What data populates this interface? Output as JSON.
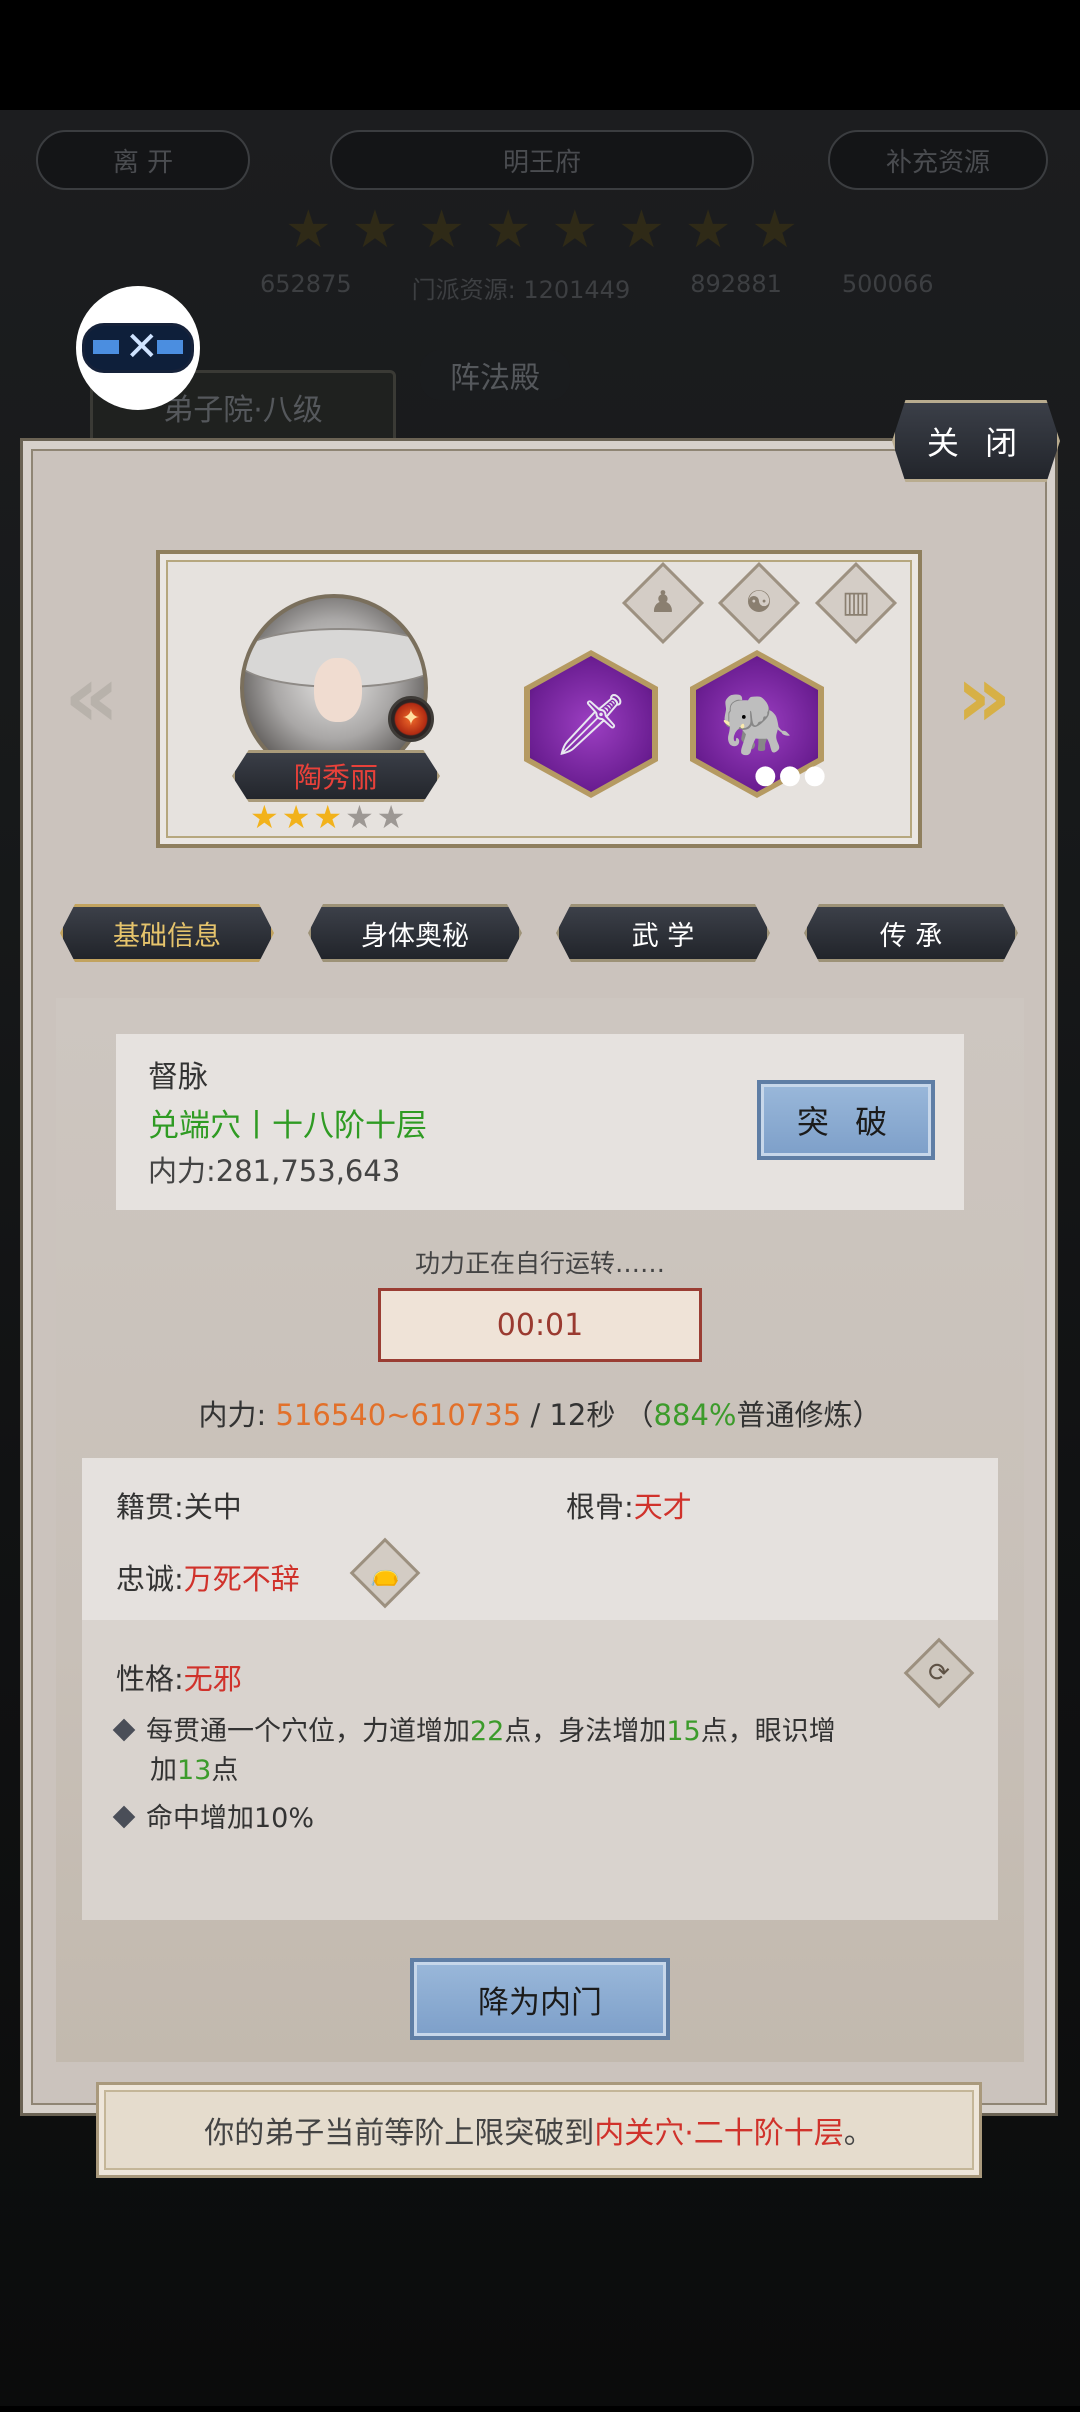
{
  "background": {
    "left_button": "离 开",
    "title": "明王府",
    "right_button": "补充资源",
    "stars_count": 8,
    "resources": [
      "652875",
      "门派资源: 1201449",
      "892881",
      "500066"
    ],
    "building_label": "弟子院·八级",
    "hall_label": "阵法殿"
  },
  "panel": {
    "close_label": "关 闭",
    "disciple": {
      "name": "陶秀丽",
      "stars_filled": 3,
      "stars_total": 5
    },
    "tabs": [
      {
        "label": "基础信息",
        "active": true
      },
      {
        "label": "身体奥秘",
        "active": false
      },
      {
        "label": "武 学",
        "active": false
      },
      {
        "label": "传 承",
        "active": false
      }
    ],
    "meridian": {
      "title": "督脉",
      "level": "兑端穴丨十八阶十层",
      "power_label": "内力:",
      "power_value": "281,753,643",
      "breakthrough_label": "突 破"
    },
    "cultivation": {
      "status": "功力正在自行运转……",
      "timer": "00:01",
      "rate_label": "内力:",
      "rate_range": "516540~610735",
      "rate_interval": "/ 12秒 （",
      "rate_percent": "884%",
      "rate_mode": "普通修炼）"
    },
    "attributes": {
      "origin_label": "籍贯:",
      "origin_value": "关中",
      "bone_label": "根骨:",
      "bone_value": "天才",
      "loyalty_label": "忠诚:",
      "loyalty_value": "万死不辞"
    },
    "trait": {
      "label": "性格:",
      "value": "无邪",
      "line1_a": "每贯通一个穴位，力道增加",
      "line1_n1": "22",
      "line1_b": "点，身法增加",
      "line1_n2": "15",
      "line1_c": "点，眼识增",
      "line1b_a": "加",
      "line1b_n3": "13",
      "line1b_b": "点",
      "line2": "命中增加10%"
    },
    "demote_label": "降为内门"
  },
  "notice": {
    "prefix": "你的弟子当前等阶上限突破到",
    "highlight": "内关穴·二十阶十层",
    "suffix": "。"
  },
  "colors": {
    "accent_green": "#3c9b2b",
    "accent_red": "#d0322b",
    "accent_orange": "#e2702a",
    "button_blue": "#8aabd2"
  },
  "icons": [
    "logo-icon",
    "arrow-left-icon",
    "arrow-right-icon",
    "fire-element-icon",
    "figure-icon",
    "yin-yang-icon",
    "book-icon",
    "saber-icon",
    "elephant-mount-icon",
    "bag-icon",
    "refresh-icon"
  ]
}
